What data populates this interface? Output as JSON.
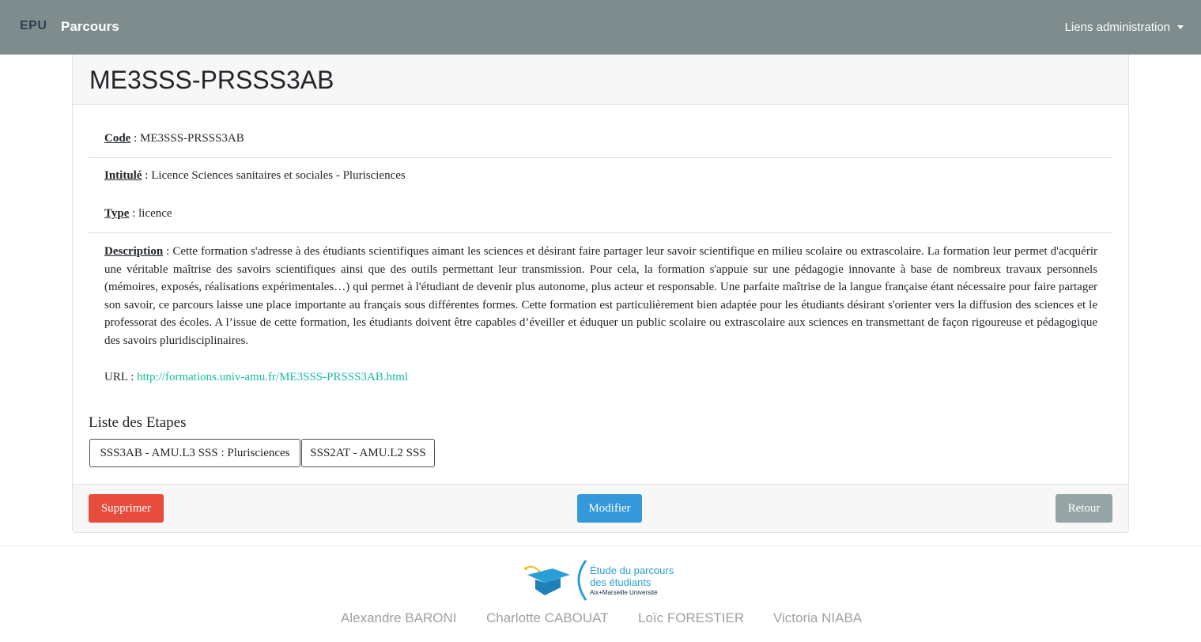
{
  "navbar": {
    "brand_short": "EPU",
    "brand_name": "Parcours",
    "admin_menu_label": "Liens administration"
  },
  "page": {
    "title": "ME3SSS-PRSSS3AB"
  },
  "details": {
    "code_label": "Code",
    "code_value": "ME3SSS-PRSSS3AB",
    "intitule_label": "Intitulé",
    "intitule_value": "Licence Sciences sanitaires et sociales - Plurisciences",
    "type_label": "Type",
    "type_value": "licence",
    "description_label": "Description",
    "description_value": "Cette formation s'adresse à des étudiants scientifiques aimant les sciences et désirant faire partager leur savoir scientifique en milieu scolaire ou extrascolaire. La formation leur permet d'acquérir une véritable maîtrise des savoirs scientifiques ainsi que des outils permettant leur transmission. Pour cela, la formation s'appuie sur une pédagogie innovante à base de nombreux travaux personnels (mémoires, exposés, réalisations expérimentales…) qui permet à l'étudiant de devenir plus autonome, plus acteur et responsable. Une parfaite maîtrise de la langue française étant nécessaire pour faire partager son savoir, ce parcours laisse une place importante au français sous différentes formes. Cette formation est particulièrement bien adaptée pour les étudiants désirant s'orienter vers la diffusion des sciences et le professorat des écoles. A l’issue de cette formation, les étudiants doivent être capables d’éveiller et éduquer un public scolaire ou extrascolaire aux sciences en transmettant de façon rigoureuse et pédagogique des savoirs pluridisciplinaires.",
    "url_label": "URL",
    "url_value": "http://formations.univ-amu.fr/ME3SSS-PRSSS3AB.html"
  },
  "etapes": {
    "title": "Liste des Etapes",
    "items": [
      "SSS3AB - AMU.L3 SSS : Plurisciences",
      "SSS2AT - AMU.L2 SSS"
    ]
  },
  "actions": {
    "delete_label": "Supprimer",
    "edit_label": "Modifier",
    "back_label": "Retour"
  },
  "footer": {
    "logo_line1": "Étude du parcours",
    "logo_line2": "des étudiants",
    "logo_line3": "Aix+Marseille Université",
    "authors": [
      "Alexandre BARONI",
      "Charlotte CABOUAT",
      "Loïc FORESTIER",
      "Victoria NIABA"
    ]
  },
  "colors": {
    "navbar": "#7e8c8d",
    "danger": "#e74c3c",
    "primary": "#3498db",
    "secondary": "#95a5a6",
    "link": "#18bc9c"
  }
}
